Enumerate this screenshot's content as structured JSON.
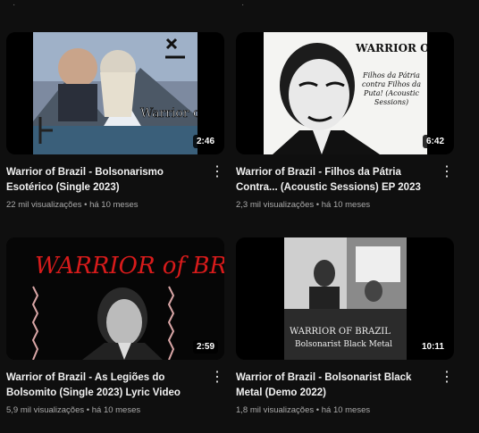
{
  "videos": [
    {
      "title": "Warrior of Brazil - Bolsonarismo Esotérico (Single 2023)",
      "views": "22 mil visualizações",
      "age": "há 10 meses",
      "duration": "2:46",
      "art_text": "Warrior of Brazil",
      "icon": "esoteric-album-art"
    },
    {
      "title": "Warrior of Brazil - Filhos da Pátria Contra... (Acoustic Sessions) EP 2023",
      "views": "2,3 mil visualizações",
      "age": "há 10 meses",
      "duration": "6:42",
      "art_text": "WARRIOR OF BRAZIL",
      "art_caption": "Filhos da Pátria contra Filhos da Puta! (Acoustic Sessions)",
      "icon": "portrait-album-art"
    },
    {
      "title": "Warrior of Brazil - As Legiões do Bolsomito (Single 2023) Lyric Video",
      "views": "5,9 mil visualizações",
      "age": "há 10 meses",
      "duration": "2:59",
      "art_text": "WARRIOR of BRAZIL",
      "icon": "red-logo-album-art"
    },
    {
      "title": "Warrior of Brazil - Bolsonarist Black Metal (Demo 2022)",
      "views": "1,8 mil visualizações",
      "age": "há 10 meses",
      "duration": "10:11",
      "art_text": "WARRIOR OF BRAZIL",
      "art_caption": "Bolsonarist Black Metal",
      "icon": "collage-album-art"
    }
  ],
  "separator": "•",
  "colors": {
    "background": "#0f0f0f",
    "title": "#f1f1f1",
    "meta": "#aaaaaa",
    "accent_red": "#d81b1b"
  }
}
